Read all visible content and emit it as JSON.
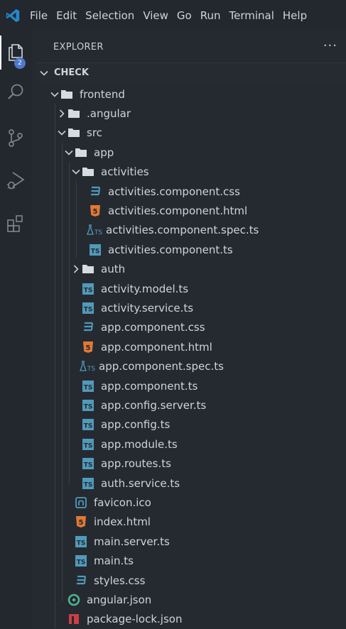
{
  "menubar": {
    "items": [
      "File",
      "Edit",
      "Selection",
      "View",
      "Go",
      "Run",
      "Terminal",
      "Help"
    ]
  },
  "activitybar": {
    "explorer_badge": "2"
  },
  "explorer": {
    "title": "EXPLORER",
    "more_actions": "···",
    "section": "CHECK"
  },
  "tree": [
    {
      "name": "frontend",
      "type": "folder",
      "expanded": true
    },
    {
      "name": ".angular",
      "type": "folder",
      "expanded": false
    },
    {
      "name": "src",
      "type": "folder",
      "expanded": true
    },
    {
      "name": "app",
      "type": "folder",
      "expanded": true
    },
    {
      "name": "activities",
      "type": "folder",
      "expanded": true
    },
    {
      "name": "activities.component.css",
      "type": "css"
    },
    {
      "name": "activities.component.html",
      "type": "html"
    },
    {
      "name": "activities.component.spec.ts",
      "type": "spec"
    },
    {
      "name": "activities.component.ts",
      "type": "ts"
    },
    {
      "name": "auth",
      "type": "folder",
      "expanded": false
    },
    {
      "name": "activity.model.ts",
      "type": "ts"
    },
    {
      "name": "activity.service.ts",
      "type": "ts"
    },
    {
      "name": "app.component.css",
      "type": "css"
    },
    {
      "name": "app.component.html",
      "type": "html"
    },
    {
      "name": "app.component.spec.ts",
      "type": "spec"
    },
    {
      "name": "app.component.ts",
      "type": "ts"
    },
    {
      "name": "app.config.server.ts",
      "type": "ts"
    },
    {
      "name": "app.config.ts",
      "type": "ts"
    },
    {
      "name": "app.module.ts",
      "type": "ts"
    },
    {
      "name": "app.routes.ts",
      "type": "ts"
    },
    {
      "name": "auth.service.ts",
      "type": "ts"
    },
    {
      "name": "favicon.ico",
      "type": "ico"
    },
    {
      "name": "index.html",
      "type": "html"
    },
    {
      "name": "main.server.ts",
      "type": "ts"
    },
    {
      "name": "main.ts",
      "type": "ts"
    },
    {
      "name": "styles.css",
      "type": "css"
    },
    {
      "name": "angular.json",
      "type": "angular"
    },
    {
      "name": "package-lock.json",
      "type": "npm"
    }
  ],
  "colors": {
    "accent": "#4d78cc",
    "ts": "#519aba",
    "html": "#e37933",
    "css": "#519aba",
    "angular": "#4fb38f",
    "npm": "#cc3e44"
  }
}
